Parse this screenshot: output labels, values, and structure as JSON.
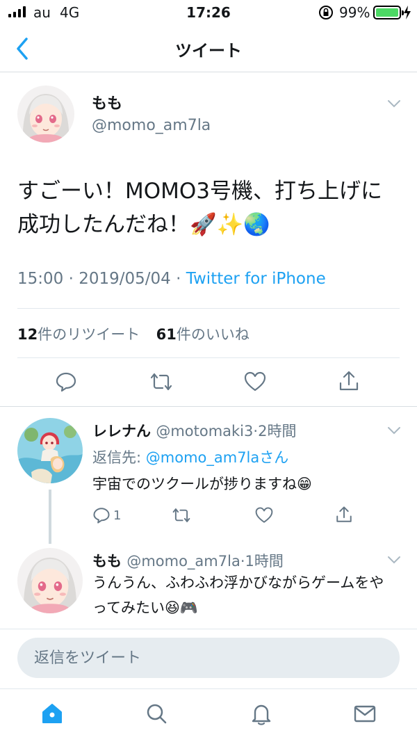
{
  "status_bar": {
    "carrier": "au",
    "network": "4G",
    "time": "17:26",
    "battery_percent": "99%",
    "battery_color": "#4cd964"
  },
  "nav": {
    "title": "ツイート",
    "back_icon": "chevron-left-icon"
  },
  "tweet": {
    "name": "もも",
    "handle": "@momo_am7la",
    "text": "すごーい！MOMO3号機、打ち上げに成功したんだね！🚀✨🌏",
    "time": "15:00",
    "date": "2019/05/04",
    "source": "Twitter for iPhone",
    "retweet_count": "12",
    "retweet_label": "件のリツイート",
    "like_count": "61",
    "like_label": "件のいいね"
  },
  "replies": [
    {
      "name": "レレナん",
      "handle": "@motomaki3",
      "time": "2時間",
      "reply_to_prefix": "返信先: ",
      "reply_to": "@momo_am7laさん",
      "text": "宇宙でのツクールが捗りますね😁",
      "reply_count": "1"
    },
    {
      "name": "もも",
      "handle": "@momo_am7la",
      "time": "1時間",
      "text": "うんうん、ふわふわ浮かびながらゲームをやってみたい😆🎮"
    }
  ],
  "composer": {
    "placeholder": "返信をツイート"
  },
  "colors": {
    "accent": "#1da1f2",
    "secondary_text": "#657786",
    "primary_text": "#14171a"
  }
}
